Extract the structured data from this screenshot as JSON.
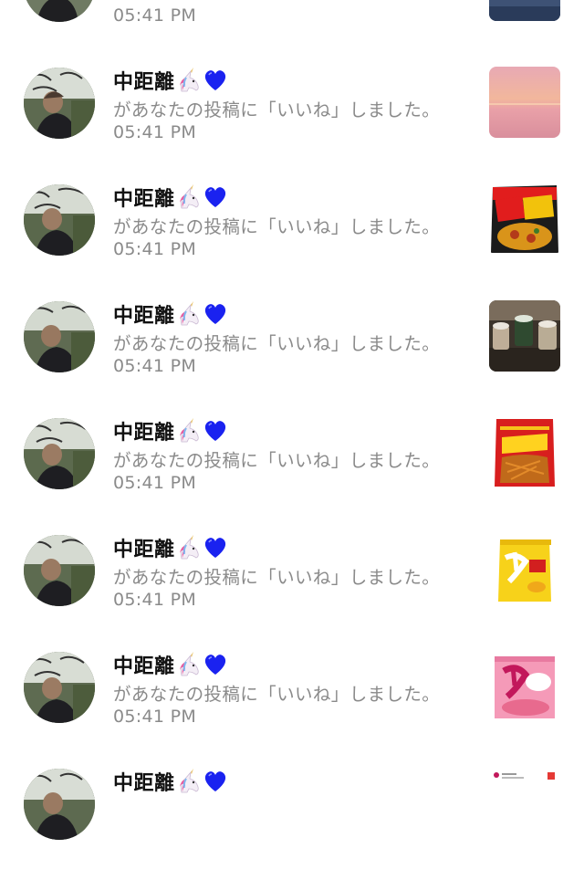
{
  "notifications": [
    {
      "name": "",
      "message": "",
      "time": "05:41 PM",
      "thumbnail": "sea-photo-thumbnail",
      "avatar": "user-avatar"
    },
    {
      "name": "中距離",
      "badge_icons": [
        "unicorn-icon",
        "blue-heart-icon"
      ],
      "message": "があなたの投稿に「いいね」しました。",
      "time": "05:41 PM",
      "thumbnail": "sunset-beach-thumbnail",
      "avatar": "user-avatar"
    },
    {
      "name": "中距離",
      "badge_icons": [
        "unicorn-icon",
        "blue-heart-icon"
      ],
      "message": "があなたの投稿に「いいね」しました。",
      "time": "05:41 PM",
      "thumbnail": "pizza-potato-chips-thumbnail",
      "avatar": "user-avatar"
    },
    {
      "name": "中距離",
      "badge_icons": [
        "unicorn-icon",
        "blue-heart-icon"
      ],
      "message": "があなたの投稿に「いいね」しました。",
      "time": "05:41 PM",
      "thumbnail": "cafe-drinks-thumbnail",
      "avatar": "user-avatar"
    },
    {
      "name": "中距離",
      "badge_icons": [
        "unicorn-icon",
        "blue-heart-icon"
      ],
      "message": "があなたの投稿に「いいね」しました。",
      "time": "05:41 PM",
      "thumbnail": "karamucho-chips-thumbnail",
      "avatar": "user-avatar"
    },
    {
      "name": "中距離",
      "badge_icons": [
        "unicorn-icon",
        "blue-heart-icon"
      ],
      "message": "があなたの投稿に「いいね」しました。",
      "time": "05:41 PM",
      "thumbnail": "yellow-snack-thumbnail",
      "avatar": "user-avatar"
    },
    {
      "name": "中距離",
      "badge_icons": [
        "unicorn-icon",
        "blue-heart-icon"
      ],
      "message": "があなたの投稿に「いいね」しました。",
      "time": "05:41 PM",
      "thumbnail": "pink-snack-thumbnail",
      "avatar": "user-avatar"
    },
    {
      "name": "中距離",
      "badge_icons": [
        "unicorn-icon",
        "blue-heart-icon"
      ],
      "message": "",
      "time": "",
      "thumbnail": "text-post-thumbnail",
      "avatar": "user-avatar"
    }
  ],
  "colors": {
    "name": "#111111",
    "secondary_text": "#8a8a8a",
    "heart": "#1a22f0",
    "background": "#ffffff"
  }
}
